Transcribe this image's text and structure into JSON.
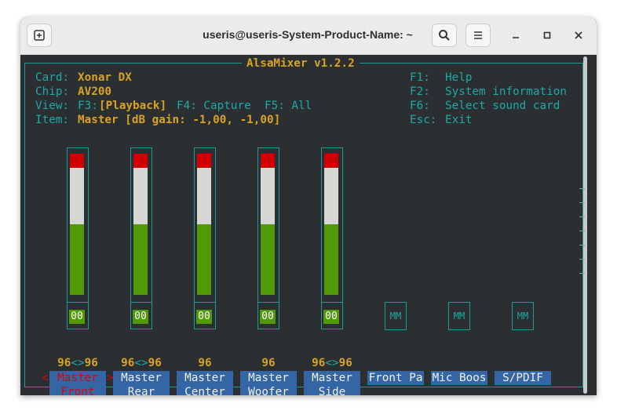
{
  "window": {
    "title": "useris@useris-System-Product-Name: ~"
  },
  "mixer": {
    "name": "AlsaMixer v1.2.2",
    "card_label": "Card:",
    "card": "Xonar DX",
    "chip_label": "Chip:",
    "chip": "AV200",
    "view_label": "View:",
    "view_f3": "F3:",
    "view_playback": "[Playback]",
    "view_f4": "F4: Capture",
    "view_f5": "F5: All",
    "item_label": "Item:",
    "item": "Master [dB gain: -1,00, -1,00]",
    "keys": [
      {
        "key": "F1:",
        "action": "Help"
      },
      {
        "key": "F2:",
        "action": "System information"
      },
      {
        "key": "F6:",
        "action": "Select sound card"
      },
      {
        "key": "Esc:",
        "action": "Exit"
      }
    ],
    "channels": [
      {
        "value": "96<>96",
        "v1": "96",
        "arrows": "<>",
        "v2": "96",
        "line1": "Master",
        "line2": "Front",
        "status": "00",
        "level_pct": 50,
        "selected": true
      },
      {
        "value": "96<>96",
        "v1": "96",
        "arrows": "<>",
        "v2": "96",
        "line1": "Master",
        "line2": "Rear",
        "status": "00",
        "level_pct": 50
      },
      {
        "value": "96",
        "line1": "Master",
        "line2": "Center",
        "status": "00",
        "level_pct": 50
      },
      {
        "value": "96",
        "line1": "Master",
        "line2": "Woofer",
        "status": "00",
        "level_pct": 50
      },
      {
        "value": "96<>96",
        "v1": "96",
        "arrows": "<>",
        "v2": "96",
        "line1": "Master",
        "line2": "Side",
        "status": "00",
        "level_pct": 50
      }
    ],
    "switches": [
      {
        "label": "Front Pa",
        "status": "MM"
      },
      {
        "label": "Mic Boos",
        "status": "MM"
      },
      {
        "label": "S/PDIF",
        "status": "MM"
      }
    ],
    "select_left": "<",
    "select_right": ">"
  }
}
